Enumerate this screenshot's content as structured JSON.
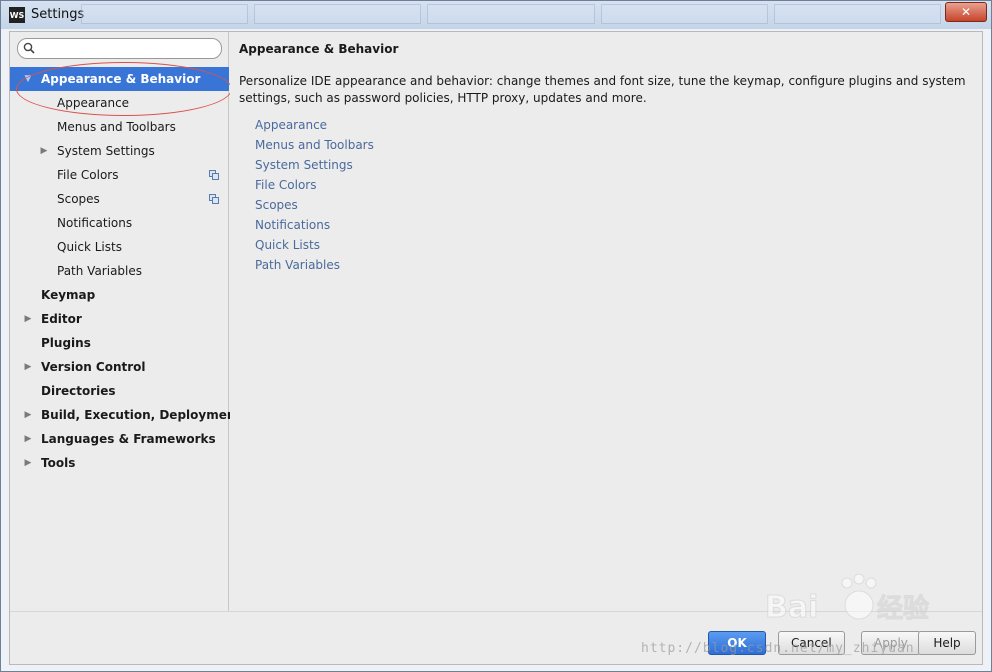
{
  "window": {
    "title": "Settings",
    "app_icon": "WS",
    "close_label": "✕"
  },
  "search": {
    "placeholder": "",
    "value": ""
  },
  "sidebar": {
    "items": [
      {
        "label": "Appearance & Behavior",
        "level": 0,
        "expanded": true,
        "selected": true,
        "bold": true
      },
      {
        "label": "Appearance",
        "level": 1
      },
      {
        "label": "Menus and Toolbars",
        "level": 1
      },
      {
        "label": "System Settings",
        "level": 1,
        "collapsed": true
      },
      {
        "label": "File Colors",
        "level": 1,
        "project_icon": true
      },
      {
        "label": "Scopes",
        "level": 1,
        "project_icon": true
      },
      {
        "label": "Notifications",
        "level": 1
      },
      {
        "label": "Quick Lists",
        "level": 1
      },
      {
        "label": "Path Variables",
        "level": 1
      },
      {
        "label": "Keymap",
        "level": 0,
        "bold": true
      },
      {
        "label": "Editor",
        "level": 0,
        "bold": true,
        "collapsed": true
      },
      {
        "label": "Plugins",
        "level": 0,
        "bold": true
      },
      {
        "label": "Version Control",
        "level": 0,
        "bold": true,
        "collapsed": true
      },
      {
        "label": "Directories",
        "level": 0,
        "bold": true
      },
      {
        "label": "Build, Execution, Deployment",
        "level": 0,
        "bold": true,
        "collapsed": true
      },
      {
        "label": "Languages & Frameworks",
        "level": 0,
        "bold": true,
        "collapsed": true
      },
      {
        "label": "Tools",
        "level": 0,
        "bold": true,
        "collapsed": true
      }
    ]
  },
  "main": {
    "title": "Appearance & Behavior",
    "description": "Personalize IDE appearance and behavior: change themes and font size, tune the keymap, configure plugins and system settings, such as password policies, HTTP proxy, updates and more.",
    "links": [
      "Appearance",
      "Menus and Toolbars",
      "System Settings",
      "File Colors",
      "Scopes",
      "Notifications",
      "Quick Lists",
      "Path Variables"
    ]
  },
  "buttons": {
    "ok": "OK",
    "cancel": "Cancel",
    "apply": "Apply",
    "help": "Help"
  },
  "watermark": {
    "brand": "Bai du 经验",
    "url": "http://blog.csdn.net/my_zhiyuan"
  },
  "colors": {
    "selection": "#3875d7",
    "link": "#4a6a9c",
    "ok_button": "#2d6fd8",
    "annotation": "#d9534f"
  }
}
